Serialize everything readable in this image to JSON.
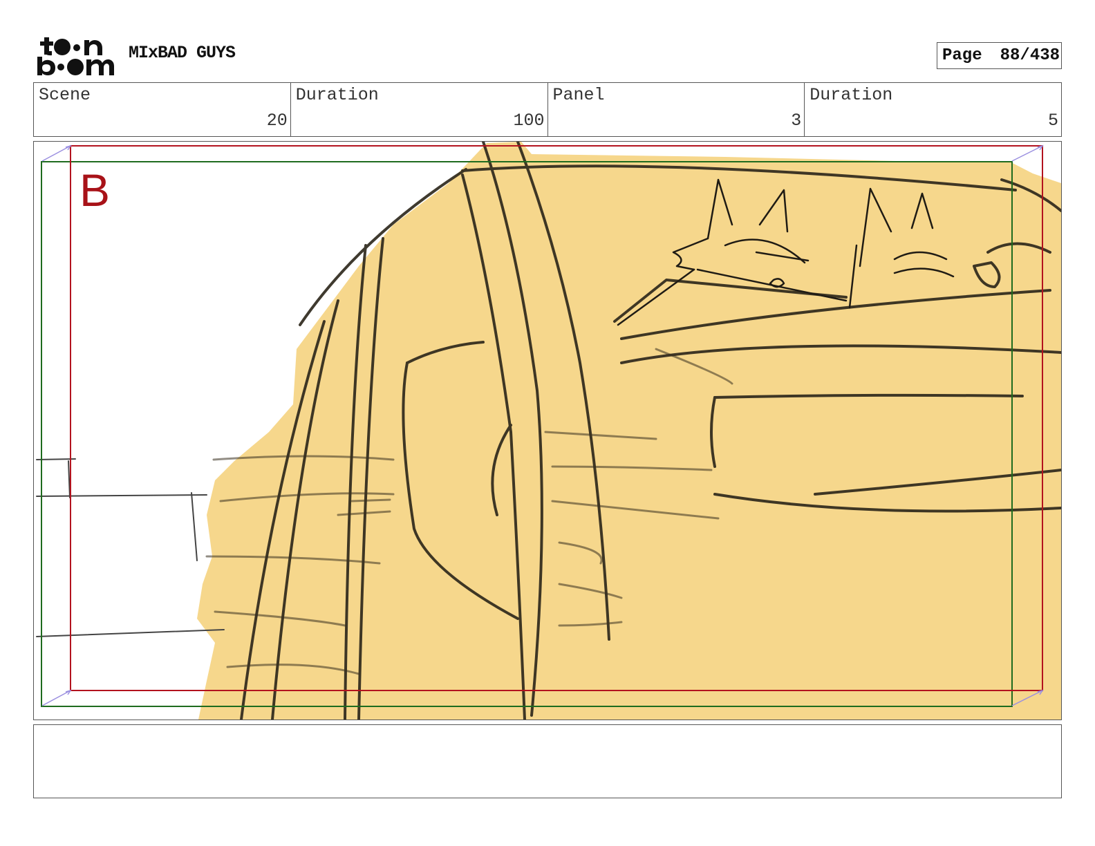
{
  "header": {
    "logo_text": "toon boom",
    "project_title": "MIxBAD GUYS",
    "page_label": "Page",
    "page_number": "88/438"
  },
  "info": {
    "scene_label": "Scene",
    "scene_value": "20",
    "scene_duration_label": "Duration",
    "scene_duration_value": "100",
    "panel_label": "Panel",
    "panel_value": "3",
    "panel_duration_label": "Duration",
    "panel_duration_value": "5"
  },
  "panel": {
    "camera_marker": "B",
    "fill_color": "#f6d78c",
    "safe_frame_color": "#b3121e",
    "field_frame_color": "#1e6b1e"
  },
  "notes": {
    "text": ""
  }
}
